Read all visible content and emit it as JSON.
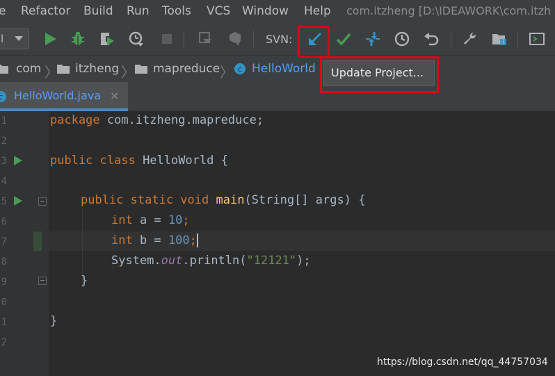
{
  "menubar": {
    "items": [
      {
        "label": "e"
      },
      {
        "label": "Refactor"
      },
      {
        "label": "Build"
      },
      {
        "label": "Run"
      },
      {
        "label": "Tools"
      },
      {
        "label": "VCS"
      },
      {
        "label": "Window"
      },
      {
        "label": "Help"
      }
    ],
    "window_title": "com.itzheng [D:\\IDEAWORK\\com.itzh"
  },
  "toolbar": {
    "run_config_label": "l",
    "svn_label": "SVN:",
    "icons": [
      "run-icon",
      "debug-icon",
      "coverage-icon",
      "profile-icon",
      "stop-icon",
      "build-icon",
      "rebuild-icon",
      "svn-update-icon",
      "svn-commit-icon",
      "svn-compare-icon",
      "svn-history-icon",
      "svn-revert-icon",
      "settings-wrench-icon",
      "project-structure-icon",
      "terminal-icon"
    ],
    "accent_update": "#3592c4",
    "accent_commit": "#499c54"
  },
  "breadcrumb": {
    "items": [
      {
        "label": "com"
      },
      {
        "label": "itzheng"
      },
      {
        "label": "mapreduce"
      },
      {
        "label": "HelloWorld"
      }
    ]
  },
  "popup": {
    "item_label": "Update Project..."
  },
  "tabs": [
    {
      "label": "HelloWorld.java",
      "close": "×"
    }
  ],
  "gutter": {
    "line_numbers": [
      "1",
      "2",
      "3",
      "4",
      "5",
      "6",
      "7",
      "8",
      "9",
      "0",
      "1",
      "2"
    ]
  },
  "code": {
    "line1_kw": "package",
    "line1_rest": " com.itzheng.mapreduce;",
    "line3_kw": "public class",
    "line3_rest": " HelloWorld {",
    "line5_kw": "public static void",
    "line5_fn": "main",
    "line5_rest": "(String[] args) {",
    "line6_kw": "int",
    "line6_mid": " a = ",
    "line6_num": "10",
    "line6_end": ";",
    "line7_kw": "int",
    "line7_mid": " b = ",
    "line7_num": "100",
    "line7_end": ";",
    "line8_a": "System.",
    "line8_static": "out",
    "line8_b": ".println(",
    "line8_str": "\"12121\"",
    "line8_c": ");",
    "line9": "}",
    "line11": "}"
  },
  "watermark": "https://blog.csdn.net/qq_44757034",
  "highlight_color": "#e0001b"
}
